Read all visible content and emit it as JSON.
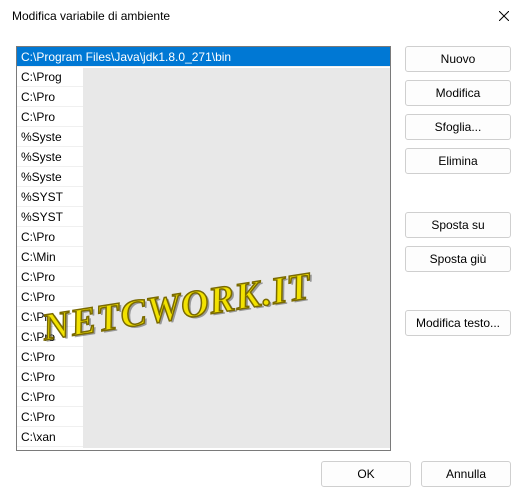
{
  "window": {
    "title": "Modifica variabile di ambiente"
  },
  "list": {
    "items": [
      "C:\\Program Files\\Java\\jdk1.8.0_271\\bin",
      "C:\\Prog",
      "C:\\Pro",
      "C:\\Pro",
      "%Syste",
      "%Syste",
      "%Syste",
      "%SYST",
      "%SYST",
      "C:\\Pro",
      "C:\\Min",
      "C:\\Pro",
      "C:\\Pro",
      "C:\\Pro",
      "C:\\Pro",
      "C:\\Pro",
      "C:\\Pro",
      "C:\\Pro",
      "C:\\Pro",
      "C:\\xan"
    ],
    "selected_index": 0
  },
  "buttons": {
    "new": "Nuovo",
    "edit": "Modifica",
    "browse": "Sfoglia...",
    "delete": "Elimina",
    "move_up": "Sposta su",
    "move_down": "Sposta giù",
    "edit_text": "Modifica testo..."
  },
  "footer": {
    "ok": "OK",
    "cancel": "Annulla"
  },
  "watermark": "NETCWORK.IT"
}
